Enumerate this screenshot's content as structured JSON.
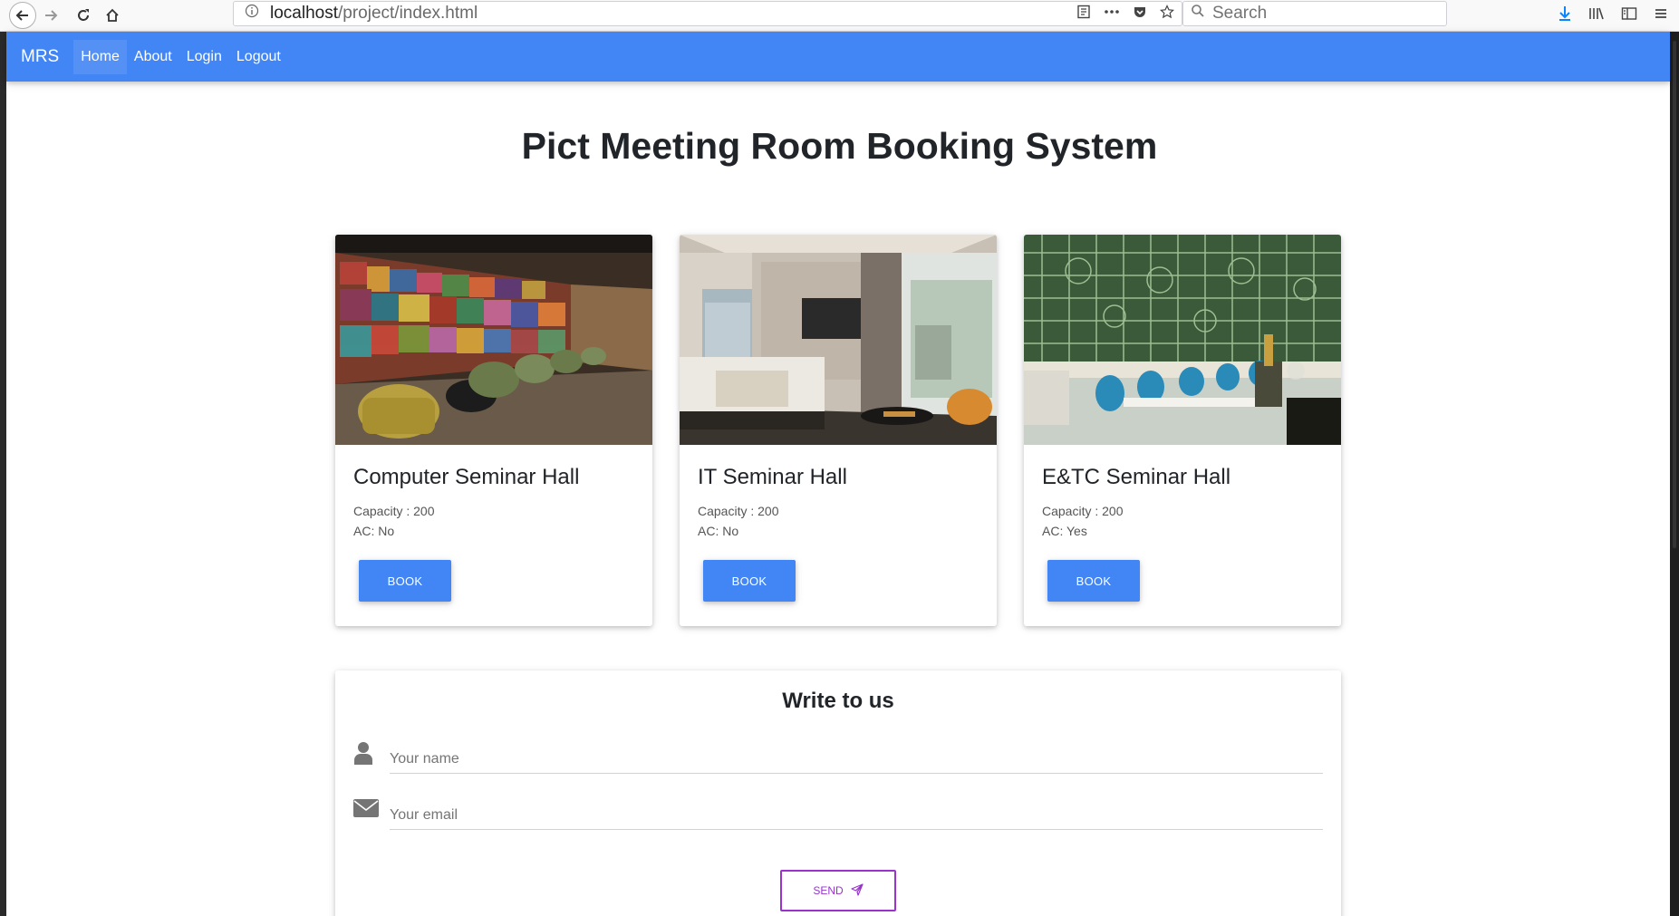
{
  "browser": {
    "url_host": "localhost",
    "url_path": "/project/index.html",
    "search_placeholder": "Search"
  },
  "navbar": {
    "brand": "MRS",
    "links": [
      {
        "label": "Home",
        "active": true
      },
      {
        "label": "About",
        "active": false
      },
      {
        "label": "Login",
        "active": false
      },
      {
        "label": "Logout",
        "active": false
      }
    ],
    "color": "#4285f4"
  },
  "page": {
    "title": "Pict Meeting Room Booking System"
  },
  "rooms": [
    {
      "name": "Computer Seminar Hall",
      "capacity": "Capacity : 200",
      "ac": "AC: No",
      "button": "BOOK"
    },
    {
      "name": "IT Seminar Hall",
      "capacity": "Capacity : 200",
      "ac": "AC: No",
      "button": "BOOK"
    },
    {
      "name": "E&TC Seminar Hall",
      "capacity": "Capacity : 200",
      "ac": "AC: Yes",
      "button": "BOOK"
    }
  ],
  "contact": {
    "title": "Write to us",
    "name_placeholder": "Your name",
    "email_placeholder": "Your email",
    "send_label": "SEND"
  },
  "colors": {
    "primary": "#4285f4",
    "send_accent": "#9933cc"
  },
  "icons": {
    "name_field": "user-icon",
    "email_field": "envelope-icon",
    "send": "paper-plane-icon"
  }
}
